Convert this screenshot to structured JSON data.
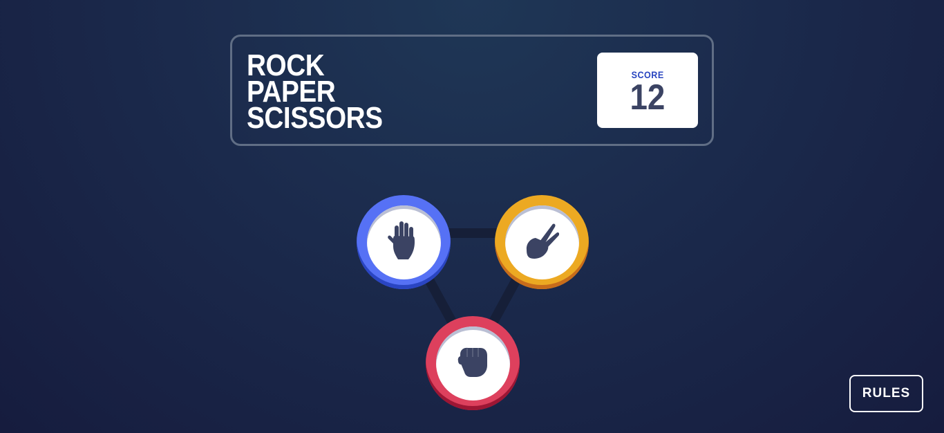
{
  "header": {
    "title_lines": [
      "ROCK",
      "PAPER",
      "SCISSORS"
    ],
    "score_label": "SCORE",
    "score_value": "12"
  },
  "choices": [
    {
      "name": "paper",
      "icon": "hand-paper-icon",
      "color": "#5671f5"
    },
    {
      "name": "scissors",
      "icon": "hand-scissors-icon",
      "color": "#eca922"
    },
    {
      "name": "rock",
      "icon": "hand-rock-icon",
      "color": "#dd405d"
    }
  ],
  "footer": {
    "rules_label": "RULES"
  }
}
